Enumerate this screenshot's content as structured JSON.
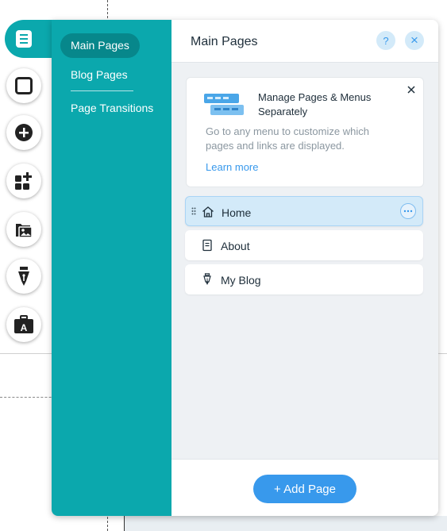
{
  "sidebar": {
    "items": [
      {
        "label": "Main Pages"
      },
      {
        "label": "Blog Pages"
      },
      {
        "label": "Page Transitions"
      }
    ]
  },
  "panel": {
    "title": "Main Pages",
    "help_icon": "?",
    "close_icon": "×"
  },
  "info_card": {
    "title": "Manage Pages & Menus Separately",
    "text": "Go to any menu to customize which pages and links are displayed.",
    "link": "Learn more"
  },
  "pages": [
    {
      "label": "Home",
      "icon": "home-icon"
    },
    {
      "label": "About",
      "icon": "page-icon"
    },
    {
      "label": "My Blog",
      "icon": "blog-pen-icon"
    }
  ],
  "footer": {
    "add_button": "+ Add Page"
  },
  "toolbar_icons": [
    "pages-icon",
    "background-icon",
    "add-icon",
    "apps-icon",
    "media-icon",
    "blog-pen-icon",
    "business-icon"
  ],
  "colors": {
    "accent_teal": "#0ba8ad",
    "accent_teal_dark": "#07878b",
    "primary_blue": "#3899ec",
    "selected_row": "#d3eaf9"
  }
}
